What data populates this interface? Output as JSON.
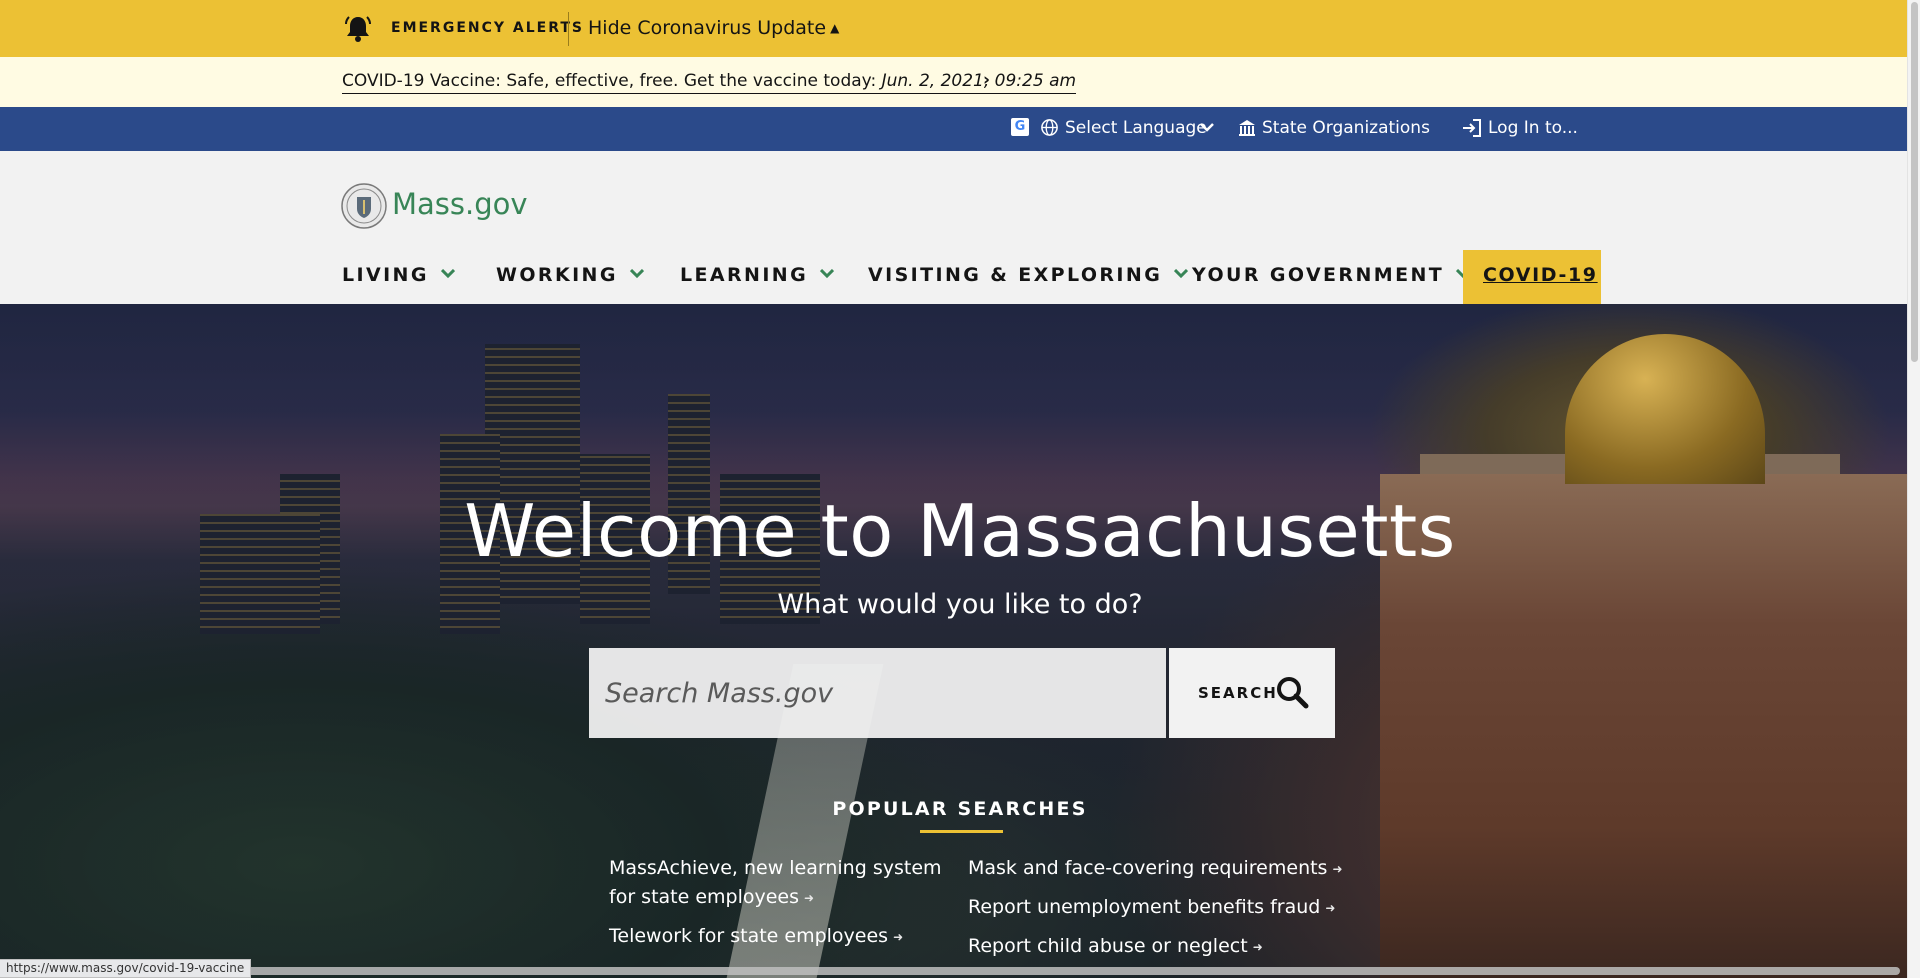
{
  "alerts": {
    "label": "EMERGENCY ALERTS",
    "toggle": "Hide Coronavirus Update",
    "notice_text": "COVID-19 Vaccine: Safe, effective, free. Get the vaccine today: ",
    "notice_date": "Jun. 2, 2021, 09:25 am"
  },
  "utility": {
    "language": "Select Language",
    "organizations": "State Organizations",
    "login": "Log In to..."
  },
  "brand": "Mass.gov",
  "nav": {
    "items": [
      "LIVING",
      "WORKING",
      "LEARNING",
      "VISITING & EXPLORING",
      "YOUR GOVERNMENT"
    ],
    "highlight": "COVID-19"
  },
  "hero": {
    "title": "Welcome to Massachusetts",
    "subtitle": "What would you like to do?",
    "search_placeholder": "Search Mass.gov",
    "search_button": "SEARCH"
  },
  "popular": {
    "heading": "POPULAR SEARCHES",
    "left": [
      "MassAchieve, new learning system for state employees",
      "Telework for state employees"
    ],
    "right": [
      "Mask and face-covering requirements",
      "Report unemployment benefits fraud",
      "Report child abuse or neglect"
    ]
  },
  "status_url": "https://www.mass.gov/covid-19-vaccine",
  "colors": {
    "alert_yellow": "#ecc134",
    "utility_blue": "#2b4a8a",
    "brand_green": "#388557"
  }
}
